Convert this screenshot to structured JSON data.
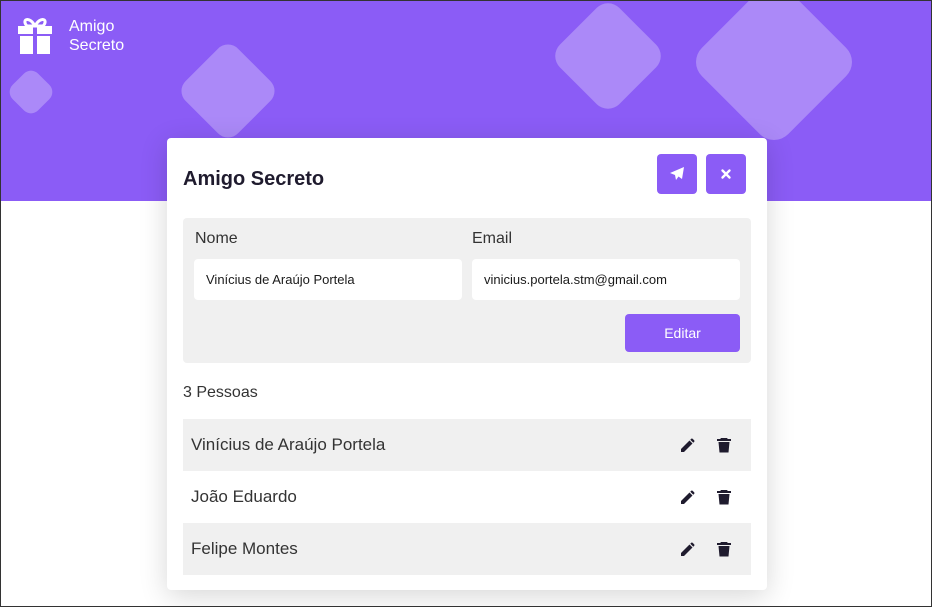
{
  "brand": {
    "line1": "Amigo",
    "line2": "Secreto",
    "icon": "gift-icon"
  },
  "card": {
    "title": "Amigo Secreto",
    "send_icon": "paper-plane-icon",
    "close_icon": "close-icon"
  },
  "form": {
    "name_label": "Nome",
    "email_label": "Email",
    "name_value": "Vinícius de Araújo Portela",
    "email_value": "vinicius.portela.stm@gmail.com",
    "submit_label": "Editar"
  },
  "people": {
    "count_label": "3 Pessoas",
    "items": [
      {
        "name": "Vinícius de Araújo Portela"
      },
      {
        "name": "João Eduardo"
      },
      {
        "name": "Felipe Montes"
      }
    ],
    "edit_icon": "pencil-icon",
    "delete_icon": "trash-icon"
  },
  "colors": {
    "accent": "#8b5cf6",
    "panel": "#f0f0f0",
    "text_dark": "#1f1b2e"
  }
}
